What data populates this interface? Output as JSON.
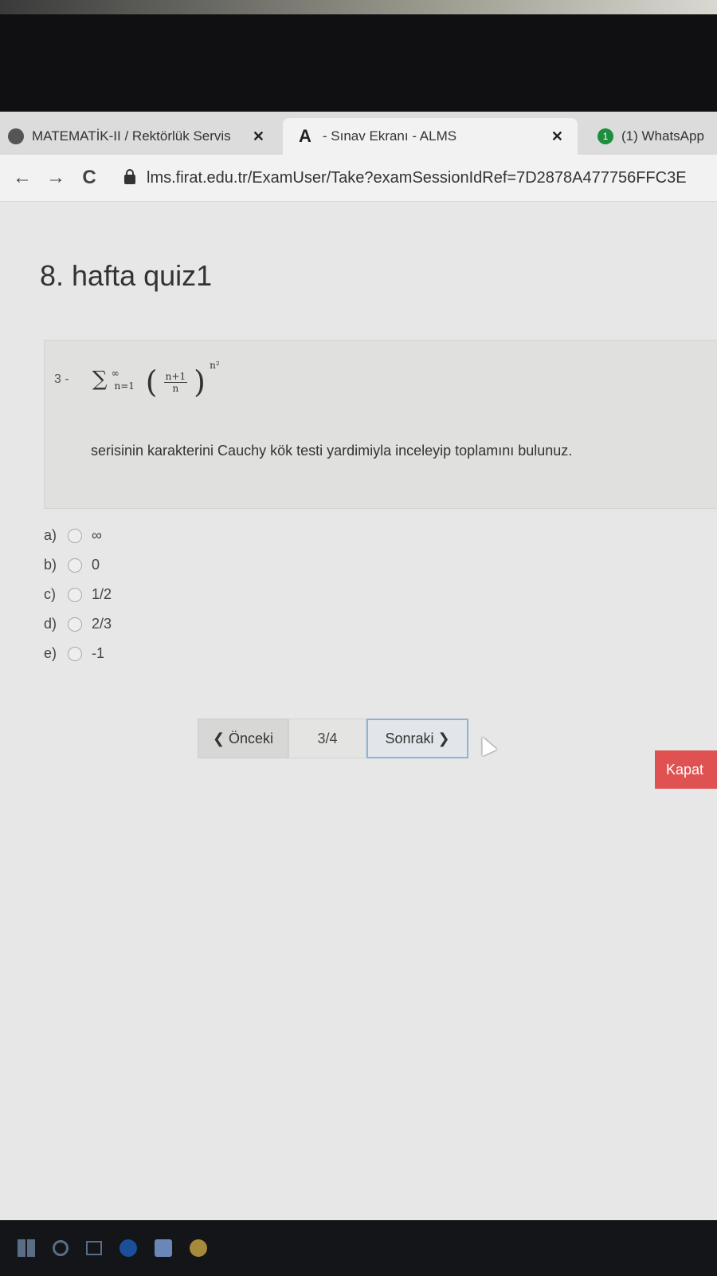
{
  "browser": {
    "tabs": [
      {
        "label": "MATEMATİK-II / Rektörlük Servis",
        "close": "✕"
      },
      {
        "icon_text": "A",
        "label": "- Sınav Ekranı - ALMS",
        "close": "✕"
      },
      {
        "badge": "1",
        "label": "(1) WhatsApp"
      }
    ],
    "nav": {
      "back": "←",
      "forward": "→",
      "reload": "C"
    },
    "url": "lms.firat.edu.tr/ExamUser/Take?examSessionIdRef=7D2878A477756FFC3E"
  },
  "exam": {
    "title": "8. hafta quiz1",
    "question": {
      "number": "3 -",
      "formula": {
        "sigma": "∑",
        "upper": "∞",
        "lower": "n=1",
        "numerator": "n+1",
        "denominator": "n",
        "exponent": "n²"
      },
      "text": "serisinin karakterini Cauchy kök testi yardimiyla inceleyip toplamını bulunuz."
    },
    "options": [
      {
        "letter": "a)",
        "value": "∞"
      },
      {
        "letter": "b)",
        "value": "0"
      },
      {
        "letter": "c)",
        "value": "1/2"
      },
      {
        "letter": "d)",
        "value": "2/3"
      },
      {
        "letter": "e)",
        "value": "-1"
      }
    ],
    "pager": {
      "prev_label": "❮ Önceki",
      "count": "3/4",
      "next_label": "Sonraki ❯"
    },
    "close_label": "Kapat"
  },
  "taskbar": {
    "icons": [
      "windows-icon",
      "search-icon",
      "task-view-icon",
      "edge-icon",
      "file-explorer-icon",
      "chrome-icon"
    ]
  }
}
